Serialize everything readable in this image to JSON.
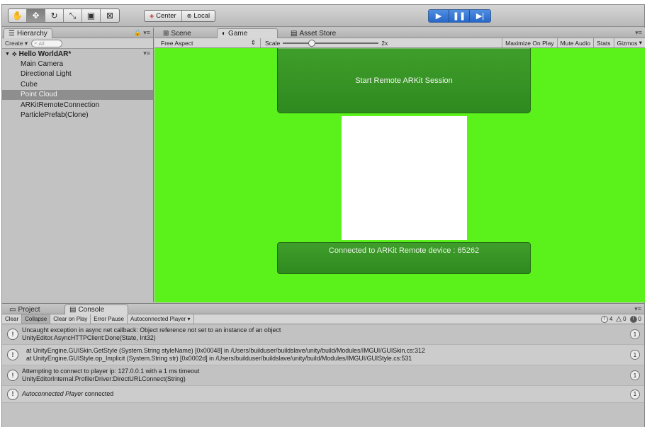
{
  "toolbar": {
    "pivot_center": "Center",
    "pivot_local": "Local"
  },
  "hierarchy": {
    "tab": "Hierarchy",
    "create": "Create",
    "search_placeholder": "All",
    "scene": "Hello WorldAR*",
    "items": [
      "Main Camera",
      "Directional Light",
      "Cube",
      "Point Cloud",
      "ARKitRemoteConnection",
      "ParticlePrefab(Clone)"
    ]
  },
  "game": {
    "tabs": {
      "scene": "Scene",
      "game": "Game",
      "asset_store": "Asset Store"
    },
    "aspect": "Free Aspect",
    "scale_label": "Scale",
    "scale_value": "2x",
    "options": [
      "Maximize On Play",
      "Mute Audio",
      "Stats",
      "Gizmos"
    ],
    "button_label": "Start Remote ARKit Session",
    "status": "Connected to ARKit Remote device : 65262"
  },
  "console": {
    "tabs": {
      "project": "Project",
      "console": "Console"
    },
    "buttons": [
      "Clear",
      "Collapse",
      "Clear on Play",
      "Error Pause",
      "Autoconnected Player"
    ],
    "counts": {
      "info": "4",
      "warning": "0",
      "error": "0"
    },
    "logs": [
      {
        "line1": "Uncaught exception in async net callback: Object reference not set to an instance of an object",
        "line2": "UnityEditor.AsyncHTTPClient:Done(State, Int32)",
        "count": "1"
      },
      {
        "line1": "at UnityEngine.GUISkin.GetStyle (System.String styleName) [0x00048] in /Users/builduser/buildslave/unity/build/Modules/IMGUI/GUISkin.cs:312",
        "line2": "at UnityEngine.GUIStyle.op_Implicit (System.String str) [0x0002d] in /Users/builduser/buildslave/unity/build/Modules/IMGUI/GUIStyle.cs:531",
        "count": "1"
      },
      {
        "line1": "Attempting to connect to player ip: 127.0.0.1 with a 1 ms timeout",
        "line2": "UnityEditorInternal.ProfilerDriver:DirectURLConnect(String)",
        "count": "1"
      },
      {
        "line1_italic": "Autoconnected Player",
        "line1_rest": " connected",
        "count": "1"
      }
    ]
  }
}
